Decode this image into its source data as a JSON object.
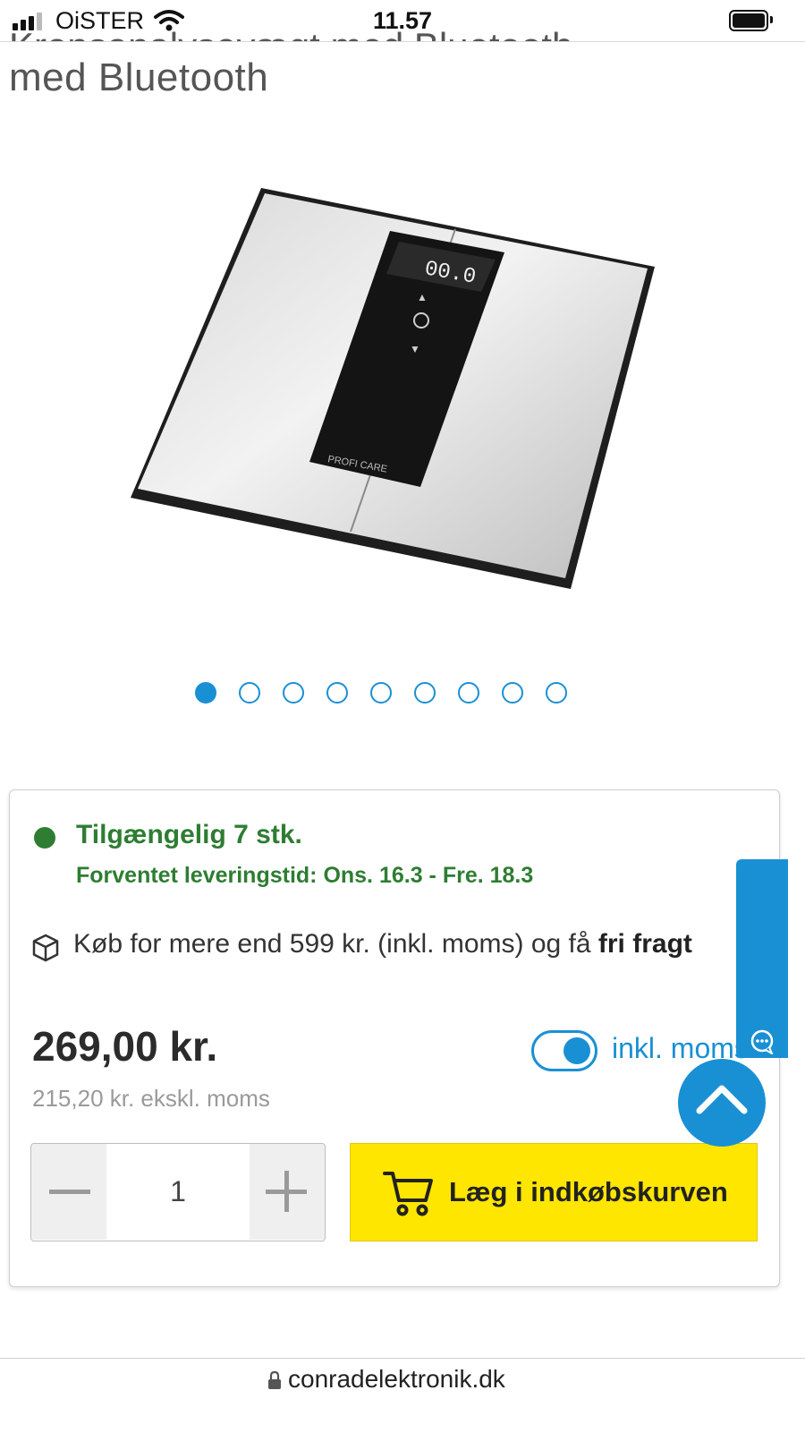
{
  "status_bar": {
    "carrier": "OiSTER",
    "time": "11.57"
  },
  "product": {
    "title_partial": "Kropsanalysevægt med Bluetooth",
    "title_line2": "med Bluetooth",
    "image": {
      "display_reading": "00.0",
      "brand": "PROFI CARE"
    },
    "gallery": {
      "count": 9,
      "active_index": 0
    }
  },
  "stock": {
    "availability": "Tilgængelig 7 stk.",
    "delivery": "Forventet leveringstid: Ons. 16.3 - Fre. 18.3",
    "status_color": "#2e7d32"
  },
  "shipping": {
    "text": "Køb for mere end 599 kr. (inkl. moms) og få ",
    "highlight": "fri fragt"
  },
  "pricing": {
    "price": "269,00 kr.",
    "price_ex_vat": "215,20 kr. ekskl. moms",
    "vat_toggle_label": "inkl. moms",
    "vat_included": true
  },
  "quantity": {
    "value": "1"
  },
  "cart": {
    "button_label": "Læg i indkøbskurven"
  },
  "feedback": {
    "label": "Feedback"
  },
  "browser": {
    "url": "conradelektronik.dk"
  },
  "colors": {
    "accent": "#1a90d4",
    "cart_button": "#ffe600",
    "available": "#2e7d32"
  }
}
